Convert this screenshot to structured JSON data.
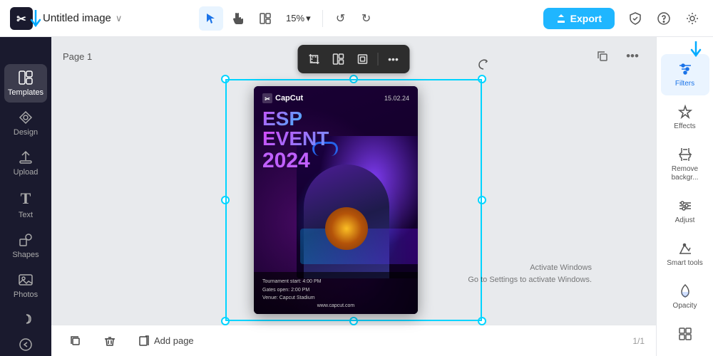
{
  "topbar": {
    "logo_text": "✂",
    "title": "Untitled image",
    "chevron": "∨",
    "tools": {
      "select_label": "▷",
      "hand_label": "✋",
      "layout_label": "⊞",
      "zoom_value": "15%",
      "zoom_chevron": "∨",
      "undo_label": "↺",
      "redo_label": "↻"
    },
    "export_label": "Export",
    "export_icon": "↑",
    "shield_icon": "🛡",
    "help_icon": "?",
    "settings_icon": "⚙"
  },
  "left_sidebar": {
    "items": [
      {
        "id": "templates",
        "icon": "⊞",
        "label": "Templates"
      },
      {
        "id": "design",
        "icon": "✦",
        "label": "Design"
      },
      {
        "id": "upload",
        "icon": "⬆",
        "label": "Upload"
      },
      {
        "id": "text",
        "icon": "T",
        "label": "Text"
      },
      {
        "id": "shapes",
        "icon": "◇",
        "label": "Shapes"
      },
      {
        "id": "photos",
        "icon": "🖼",
        "label": "Photos"
      }
    ]
  },
  "canvas": {
    "page_label": "Page 1",
    "copy_icon": "⊕",
    "more_icon": "•••"
  },
  "context_toolbar": {
    "btn1": "▣",
    "btn2": "⊞",
    "btn3": "◻",
    "more": "•••"
  },
  "poster": {
    "logo": "CapCut",
    "date": "15.02.24",
    "title_line1": "ESP",
    "title_line2": "EVENT",
    "title_line3": "2024",
    "footer_lines": [
      "Tournament start: 4:00 PM",
      "Gates open: 2:00 PM",
      "Venue: Capcut Stadium"
    ],
    "website": "www.capcut.com"
  },
  "bottom_bar": {
    "duplicate_icon": "⊕",
    "delete_icon": "🗑",
    "add_page_label": "Add page",
    "page_indicator": "1/1",
    "activate_line1": "Activate Windows",
    "activate_line2": "Go to Settings to activate Windows."
  },
  "right_sidebar": {
    "items": [
      {
        "id": "filters",
        "icon": "✦",
        "label": "Filters",
        "active": true
      },
      {
        "id": "effects",
        "icon": "★",
        "label": "Effects"
      },
      {
        "id": "remove-bg",
        "icon": "✂",
        "label": "Remove backgr..."
      },
      {
        "id": "adjust",
        "icon": "⊟",
        "label": "Adjust"
      },
      {
        "id": "smart-tools",
        "icon": "✏",
        "label": "Smart tools"
      },
      {
        "id": "opacity",
        "icon": "◉",
        "label": "Opacity"
      },
      {
        "id": "more",
        "icon": "⊞",
        "label": ""
      }
    ]
  }
}
